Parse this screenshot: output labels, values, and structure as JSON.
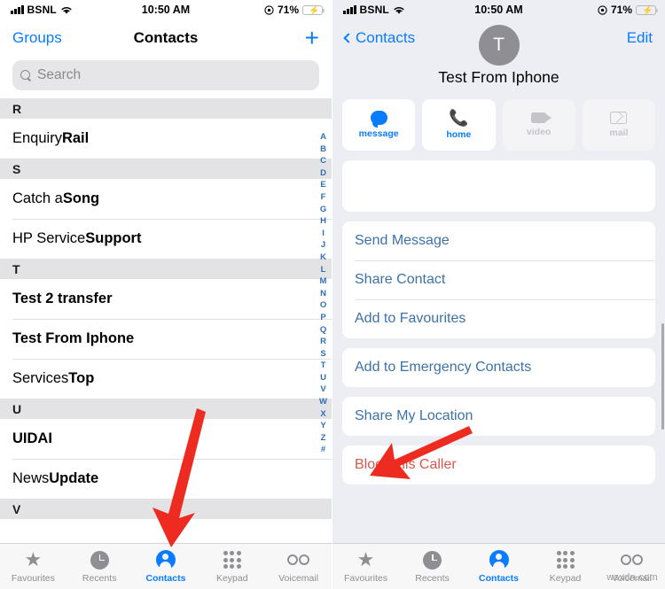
{
  "status_bar": {
    "carrier": "BSNL",
    "time": "10:50 AM",
    "battery_percent": "71%",
    "wifi_icon": "wifi-icon",
    "signal_icon": "signal-bars-icon",
    "location_icon": "location-services-icon",
    "battery_icon": "battery-charging-icon"
  },
  "left_screen": {
    "nav": {
      "groups_label": "Groups",
      "title": "Contacts",
      "add_label": "+"
    },
    "search": {
      "placeholder": "Search",
      "icon": "search-icon"
    },
    "list": [
      {
        "type": "header",
        "label": "R"
      },
      {
        "type": "contact",
        "first": "Enquiry ",
        "last": "Rail"
      },
      {
        "type": "header",
        "label": "S"
      },
      {
        "type": "contact",
        "first": "Catch a ",
        "last": "Song"
      },
      {
        "type": "contact",
        "first": "HP Service ",
        "last": "Support"
      },
      {
        "type": "header",
        "label": "T"
      },
      {
        "type": "contact",
        "first": "",
        "last": "Test 2 transfer"
      },
      {
        "type": "contact",
        "first": "",
        "last": "Test From Iphone"
      },
      {
        "type": "contact",
        "first": "Services ",
        "last": "Top"
      },
      {
        "type": "header",
        "label": "U"
      },
      {
        "type": "contact",
        "first": "",
        "last": "UIDAI"
      },
      {
        "type": "contact",
        "first": "News ",
        "last": "Update"
      },
      {
        "type": "header",
        "label": "V"
      }
    ],
    "index": [
      "A",
      "B",
      "C",
      "D",
      "E",
      "F",
      "G",
      "H",
      "I",
      "J",
      "K",
      "L",
      "M",
      "N",
      "O",
      "P",
      "Q",
      "R",
      "S",
      "T",
      "U",
      "V",
      "W",
      "X",
      "Y",
      "Z",
      "#"
    ]
  },
  "right_screen": {
    "nav": {
      "back_label": "Contacts",
      "edit_label": "Edit",
      "back_icon": "chevron-left-icon"
    },
    "contact": {
      "avatar_initial": "T",
      "name": "Test From Iphone"
    },
    "quick_actions": [
      {
        "label": "message",
        "icon": "message-bubble-icon",
        "enabled": true
      },
      {
        "label": "home",
        "icon": "phone-icon",
        "enabled": true
      },
      {
        "label": "video",
        "icon": "video-camera-icon",
        "enabled": false
      },
      {
        "label": "mail",
        "icon": "envelope-icon",
        "enabled": false
      }
    ],
    "option_groups": [
      {
        "options": []
      },
      {
        "options": [
          {
            "label": "Send Message",
            "style": "link"
          },
          {
            "label": "Share Contact",
            "style": "link"
          },
          {
            "label": "Add to Favourites",
            "style": "link"
          }
        ]
      },
      {
        "options": [
          {
            "label": "Add to Emergency Contacts",
            "style": "link"
          }
        ]
      },
      {
        "options": [
          {
            "label": "Share My Location",
            "style": "link"
          }
        ]
      },
      {
        "options": [
          {
            "label": "Block this Caller",
            "style": "danger"
          }
        ]
      }
    ]
  },
  "tab_bar": [
    {
      "label": "Favourites",
      "icon": "star-icon",
      "active": false
    },
    {
      "label": "Recents",
      "icon": "clock-icon",
      "active": false
    },
    {
      "label": "Contacts",
      "icon": "person-circle-icon",
      "active": true
    },
    {
      "label": "Keypad",
      "icon": "keypad-icon",
      "active": false
    },
    {
      "label": "Voicemail",
      "icon": "voicemail-icon",
      "active": false
    }
  ],
  "annotations": {
    "arrow_color": "#ee2b21",
    "arrow_left_target": "contacts-tab",
    "arrow_right_target": "block-this-caller-option"
  },
  "watermark": "wsxdn.com"
}
